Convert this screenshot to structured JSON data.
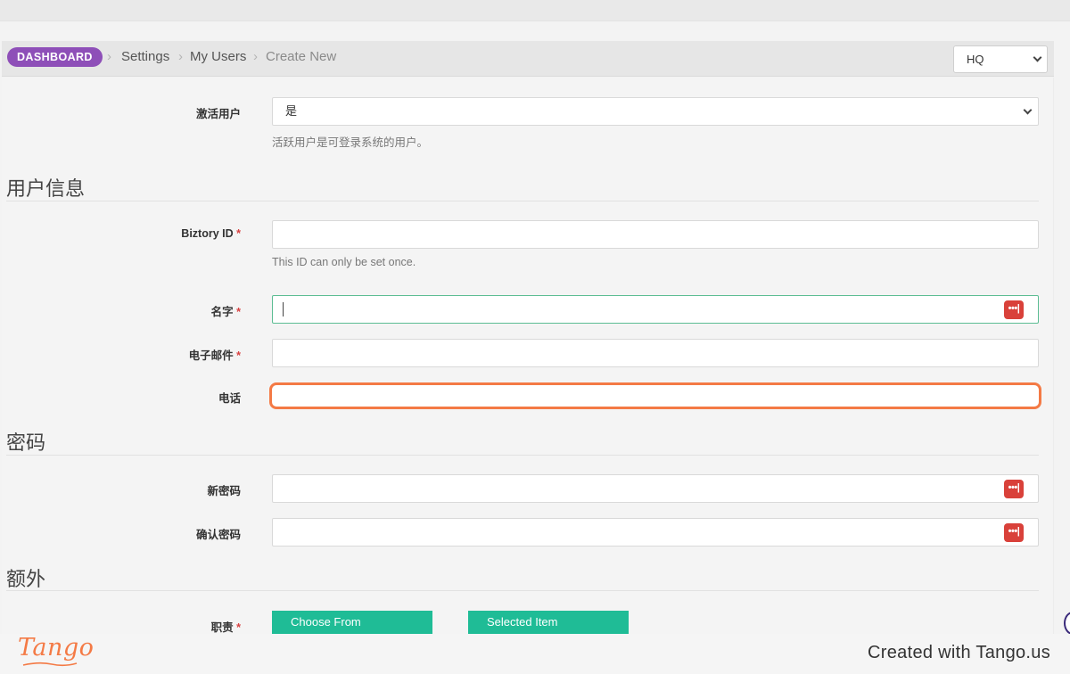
{
  "breadcrumb": {
    "dashboard": "DASHBOARD",
    "settings": "Settings",
    "my_users": "My Users",
    "create_new": "Create New",
    "separator": "›"
  },
  "branch_select": {
    "value": "HQ"
  },
  "form": {
    "active_user": {
      "label": "激活用户",
      "value": "是",
      "help": "活跃用户是可登录系统的用户。"
    },
    "section_user_info": "用户信息",
    "biztory_id": {
      "label": "Biztory ID",
      "required": "*",
      "value": "",
      "help": "This ID can only be set once."
    },
    "name": {
      "label": "名字",
      "required": "*",
      "value": ""
    },
    "email": {
      "label": "电子邮件",
      "required": "*",
      "value": ""
    },
    "phone": {
      "label": "电话",
      "value": ""
    },
    "section_password": "密码",
    "new_password": {
      "label": "新密码",
      "value": ""
    },
    "confirm_password": {
      "label": "确认密码",
      "value": ""
    },
    "section_extra": "额外",
    "roles": {
      "label": "职责",
      "required": "*",
      "choose_from": "Choose From",
      "selected_item": "Selected Item"
    }
  },
  "password_manager_icon": {
    "icon": "password-dots-icon",
    "glyph": "•••|"
  },
  "footer": {
    "logo_text": "Tango",
    "created_with": "Created with Tango.us"
  },
  "colors": {
    "dashboard_badge": "#8e4fb8",
    "highlight": "#f47a45",
    "active_border": "#5cbd93",
    "green_button": "#1fbc96",
    "password_icon": "#d9413a",
    "required": "#d84040"
  }
}
